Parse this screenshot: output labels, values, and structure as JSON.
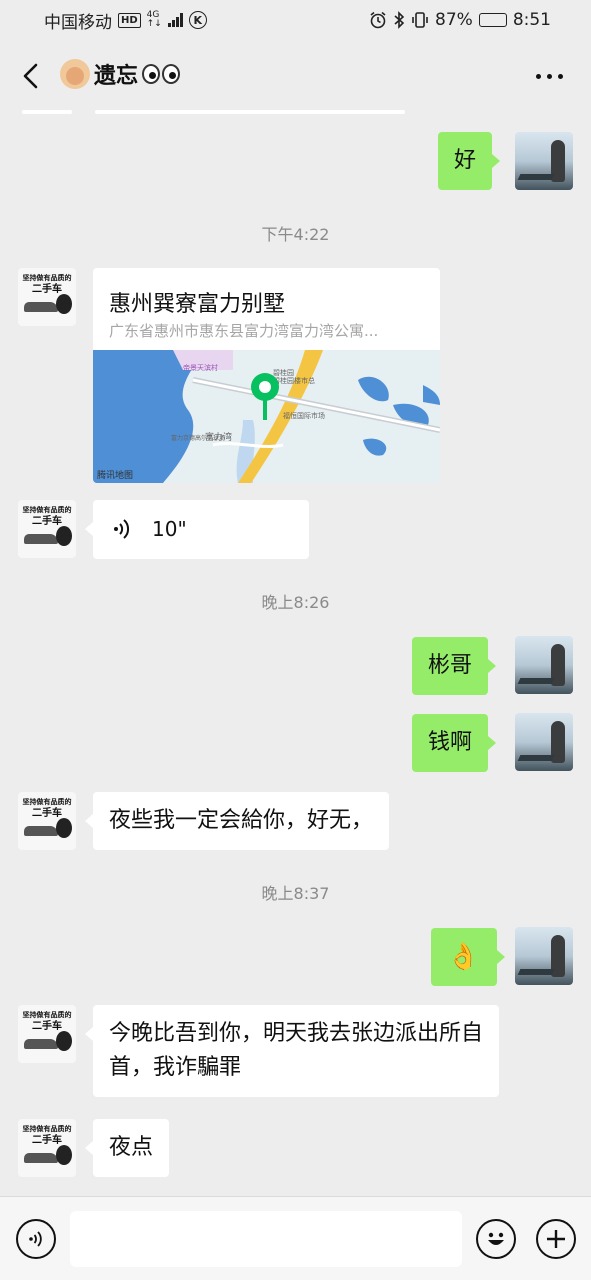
{
  "status_bar": {
    "carrier": "中国移动",
    "hd": "HD",
    "network": "4G",
    "battery": "87%",
    "battery_level": 0.87,
    "time": "8:51"
  },
  "header": {
    "title": "遗忘"
  },
  "messages": [
    {
      "id": 1,
      "side": "me",
      "type": "text",
      "text": "好"
    },
    {
      "id": 2,
      "type": "time",
      "text": "下午4:22"
    },
    {
      "id": 3,
      "side": "other",
      "type": "location",
      "name": "惠州巽寮富力别墅",
      "address": "广东省惠州市惠东县富力湾富力湾公寓...",
      "map_labels": [
        "帝景天滨村",
        "富力湾",
        "富力京德高尔夫球场",
        "福恒国际市场",
        "碧桂园",
        "碧桂园楼市总"
      ],
      "map_credit": "腾讯地图"
    },
    {
      "id": 4,
      "side": "other",
      "type": "voice",
      "duration": "10\""
    },
    {
      "id": 5,
      "type": "time",
      "text": "晚上8:26"
    },
    {
      "id": 6,
      "side": "me",
      "type": "text",
      "text": "彬哥"
    },
    {
      "id": 7,
      "side": "me",
      "type": "text",
      "text": "钱啊"
    },
    {
      "id": 8,
      "side": "other",
      "type": "text",
      "text": "夜些我一定会給你，好无，"
    },
    {
      "id": 9,
      "type": "time",
      "text": "晚上8:37"
    },
    {
      "id": 10,
      "side": "me",
      "type": "emoji",
      "text": "👌"
    },
    {
      "id": 11,
      "side": "other",
      "type": "text",
      "text": "今晚比吾到你，明天我去张边派出所自首，我诈騙罪"
    },
    {
      "id": 12,
      "side": "other",
      "type": "text",
      "text": "夜点"
    }
  ],
  "avatar_other_text": [
    "坚持做有品质的",
    "二手车"
  ],
  "input": {
    "value": "",
    "placeholder": ""
  },
  "colors": {
    "background": "#ededed",
    "bubble_me": "#95ec69",
    "bubble_other": "#ffffff",
    "timestamp": "#8a8a8a",
    "map_pin": "#07c160"
  },
  "icons": {
    "back": "chevron-left-icon",
    "more": "more-dots-icon",
    "voice": "voice-wave-icon",
    "emoji": "smiley-icon",
    "add": "plus-icon",
    "voice_input": "voice-input-icon"
  }
}
